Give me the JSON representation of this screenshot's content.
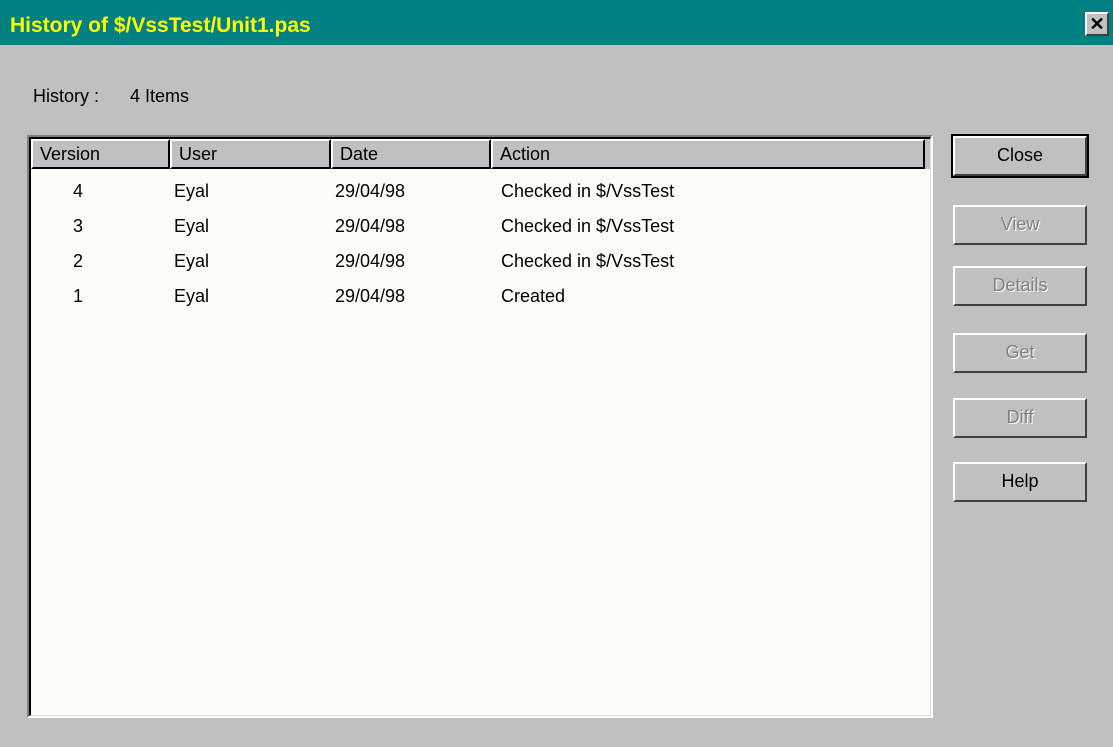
{
  "window": {
    "title": "History of $/VssTest/Unit1.pas"
  },
  "summary": {
    "label": "History :",
    "count": "4  Items"
  },
  "list": {
    "columns": [
      "Version",
      "User",
      "Date",
      "Action"
    ],
    "rows": [
      {
        "version": "4",
        "user": "Eyal",
        "date": "29/04/98",
        "action": "Checked in $/VssTest"
      },
      {
        "version": "3",
        "user": "Eyal",
        "date": "29/04/98",
        "action": "Checked in $/VssTest"
      },
      {
        "version": "2",
        "user": "Eyal",
        "date": "29/04/98",
        "action": "Checked in $/VssTest"
      },
      {
        "version": "1",
        "user": "Eyal",
        "date": "29/04/98",
        "action": "Created"
      }
    ]
  },
  "buttons": {
    "close": "Close",
    "view": "View",
    "details": "Details",
    "get": "Get",
    "diff": "Diff",
    "help": "Help"
  },
  "icons": {
    "title_close": "close-icon"
  },
  "colors": {
    "titlebar": "#008080",
    "title_text": "#ffff00",
    "face": "#c0c0c0",
    "list_bg": "#fdfdf7"
  }
}
